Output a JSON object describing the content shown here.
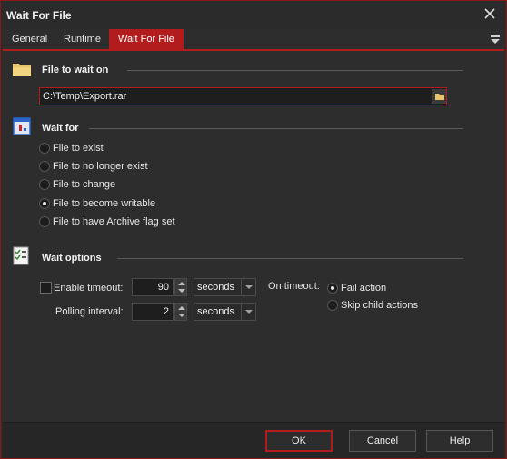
{
  "window": {
    "title": "Wait For File"
  },
  "tabs": [
    {
      "label": "General"
    },
    {
      "label": "Runtime"
    },
    {
      "label": "Wait For File"
    }
  ],
  "file_section": {
    "title": "File to wait on",
    "path_value": "C:\\Temp\\Export.rar",
    "icon": "folder-icon"
  },
  "wait_for": {
    "title": "Wait for",
    "options": [
      {
        "label": "File to exist",
        "checked": false
      },
      {
        "label": "File to no longer exist",
        "checked": false
      },
      {
        "label": "File to change",
        "checked": false
      },
      {
        "label": "File to become writable",
        "checked": true
      },
      {
        "label": "File to have Archive flag set",
        "checked": false
      }
    ]
  },
  "wait_options": {
    "title": "Wait options",
    "enable_timeout_label": "Enable timeout:",
    "enable_timeout_checked": false,
    "timeout_value": "90",
    "timeout_unit": "seconds",
    "polling_label": "Polling interval:",
    "polling_value": "2",
    "polling_unit": "seconds",
    "on_timeout_label": "On timeout:",
    "on_timeout_options": [
      {
        "label": "Fail action",
        "checked": true
      },
      {
        "label": "Skip child actions",
        "checked": false
      }
    ]
  },
  "buttons": {
    "ok": "OK",
    "cancel": "Cancel",
    "help": "Help"
  },
  "colors": {
    "accent": "#b31c1c",
    "background": "#2d2d2d",
    "input_bg": "#1e1e1e"
  }
}
